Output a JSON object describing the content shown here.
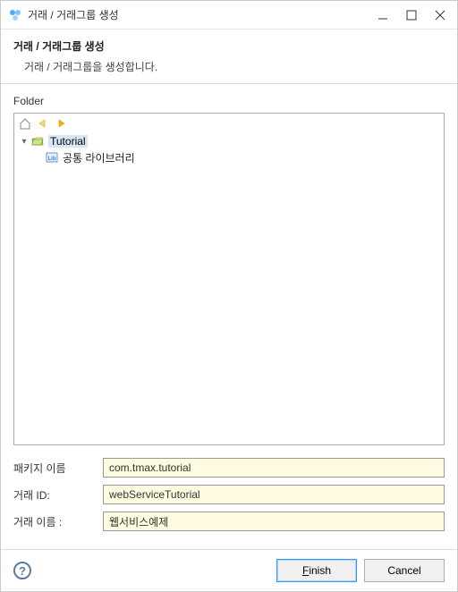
{
  "titlebar": {
    "title": "거래 / 거래그룹 생성"
  },
  "header": {
    "title": "거래 / 거래그룹 생성",
    "description": "거래 / 거래그룹을 생성합니다."
  },
  "content": {
    "folder_label": "Folder",
    "tree": {
      "root": {
        "label": "Tutorial",
        "child": {
          "label": "공통 라이브러리"
        }
      }
    },
    "form": {
      "package_label": "패키지 이름",
      "package_value": "com.tmax.tutorial",
      "tx_id_label": "거래 ID:",
      "tx_id_value": "webServiceTutorial",
      "tx_name_label": "거래 이름  :",
      "tx_name_value": "웹서비스예제"
    }
  },
  "footer": {
    "help": "?",
    "finish": "Finish",
    "cancel": "Cancel"
  }
}
